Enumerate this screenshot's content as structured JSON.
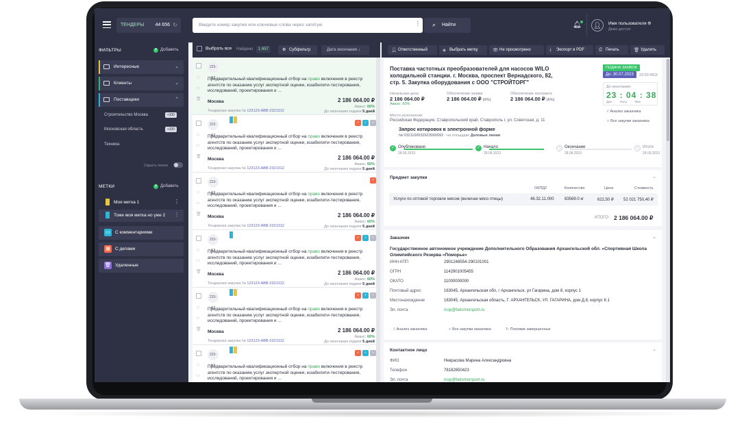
{
  "topbar": {
    "tenders_label": "ТЕНДЕРЫ",
    "tenders_count": "44 656",
    "search_placeholder": "Введите номер закупки или ключевые слова через запятую",
    "find_label": "Найти",
    "user_name": "Имя пользователя Ф",
    "user_access": "Демо доступ"
  },
  "sidebar": {
    "filters_title": "ФИЛЬТРЫ",
    "add_label": "Добавить",
    "folders": [
      {
        "label": "Интересные",
        "color": "#e8c63b"
      },
      {
        "label": "Клиенты",
        "color": "#3bb36a"
      },
      {
        "label": "Поставщики",
        "color": "#2eb5d6"
      }
    ],
    "subitems": [
      {
        "label": "Строительство Москва",
        "count": "+100"
      },
      {
        "label": "Московская область",
        "count": "+100"
      },
      {
        "label": "Техника",
        "count": ""
      }
    ],
    "hide_folders": "Скрыть папки",
    "marks_title": "МЕТКИ",
    "marks": [
      {
        "label": "Моя метка 1",
        "color": "#e8c63b"
      },
      {
        "label": "Тоже моя метка но уже 2",
        "color": "#2eb5d6"
      }
    ],
    "groups": [
      {
        "label": "С комментариями",
        "color": "#2eb5d6"
      },
      {
        "label": "С делами",
        "color": "#f06a4c"
      },
      {
        "label": "Удаленные",
        "color": "#8b6fd6"
      }
    ]
  },
  "list": {
    "select_all": "Выбрать все",
    "found_label": "Найдено",
    "found_count": "1 657",
    "subfilter": "Субфильтр",
    "sort_label": "Дата окончания",
    "card": {
      "law": "223-ФЗ",
      "title_pre": "Предварительный квалификационный отбор на ",
      "title_em": "право",
      "title_post": " включения в реестр агентств по оказанию услуг экспертной оценки, юзабилити-тестирования, исследований, проектирования и ...",
      "city": "Москва",
      "price": "2 186 064.00 ₽",
      "adv_label": "Аванс:",
      "adv_value": "60%",
      "tender_label": "Тендерная закупка №",
      "tender_num": "123123-ABB-2321312",
      "dead_label": "До окончания подачи",
      "dead_value": "5 дней"
    }
  },
  "detail": {
    "buttons": [
      "Ответственный",
      "Выбрать метку",
      "Не просмотрено",
      "Экспорт в PDF",
      "Печать",
      "Удалить"
    ],
    "title": "Поставка частотных преобразователей для насосов WILO холодильной станции. г. Москва, проспект Вернадского, 82, стр. 5. Закупка оборудования с ООО \"СТРОЙТОРГ\"",
    "status_badge": "ПОДАЧА ЗАЯВОК",
    "date_to": "До: 30.07.2023",
    "date_time": "23:00 МСК",
    "countdown_label": "До окончания:",
    "countdown": "23 : 04 : 38",
    "countdown_units": "Дни Часы Мин",
    "prices": [
      {
        "label": "Начальная цена",
        "value": "2 186 064.00 ₽",
        "pct": "Аванс: 60%"
      },
      {
        "label": "Обеспечение заявки",
        "value": "2 186 064.00 ₽",
        "pct": "(6%)"
      },
      {
        "label": "Обеспечение контракта",
        "value": "2 186 064.00 ₽",
        "pct": "(6%)"
      }
    ],
    "place_label": "Место исполнения",
    "place": "Российская Федерация, Ставропольский край, Ставрополь г, ул. Советская, д. 11",
    "proc_type": "Запрос котировок в электронной форме",
    "proc_num": "№ 0321100032623000092",
    "proc_site": "на площадке",
    "proc_site_name": "Деловые линии",
    "links_right": [
      "Анализ заказчика",
      "Все закупки заказчика"
    ],
    "stages": [
      {
        "label": "Опубликовано",
        "date": "28.06.2023"
      },
      {
        "label": "Начало",
        "date": "28.06.2023"
      },
      {
        "label": "Окончание",
        "date": "28.08.2023"
      },
      {
        "label": "Итоги",
        "date": "28.09.2023"
      }
    ],
    "subject": {
      "title": "Предмет закупки",
      "headers": [
        "ОКПД2",
        "Количество",
        "Цена",
        "Стоимость"
      ],
      "row": {
        "name": "Услуги по оптовой торговле мясом (включая мясо птицы)",
        "okpd": "46.32.11.000",
        "qty": "83569.0 кг",
        "price": "622,50 ₽",
        "cost": "52 021 750,40 ₽"
      },
      "total_label": "ИТОГО:",
      "total_value": "2 186 064.00 ₽"
    },
    "customer": {
      "title": "Заказчик",
      "name": "Государственное автономное учреждение Дополнительного Образования Архангельской обл. «Спортивная Школа Олимпийского Резерва «Поморье»",
      "fields": [
        {
          "k": "ИНН-КПП",
          "v": "2901248554-290101001"
        },
        {
          "k": "ОГРН",
          "v": "1142901005455"
        },
        {
          "k": "ОКАТО",
          "v": "11000000000"
        },
        {
          "k": "Почтовый адрес",
          "v": "163045, Архангельская обл, г Архангельск, ул Гагарина, дом 8, корпус 1"
        },
        {
          "k": "Местонахождение",
          "v": "163045, Архангельская область, Г. АРХАНГЕЛЬСК, УЛ. ГАГАРИНА, дом Д.8, корпус К.1"
        },
        {
          "k": "Эл. почта",
          "v": "rcsp@belomorsport.ru"
        }
      ],
      "links": [
        "Анализ заказчика",
        "Все закупки заказчика",
        "Похожие завершенные"
      ]
    },
    "contact": {
      "title": "Контактное лицо",
      "fields": [
        {
          "k": "ФИО",
          "v": "Некрасова Марина Александровна"
        },
        {
          "k": "Телефон",
          "v": "78182650423"
        },
        {
          "k": "Эл. почта",
          "v": "rcsp@belomorsport.ru"
        }
      ]
    }
  }
}
